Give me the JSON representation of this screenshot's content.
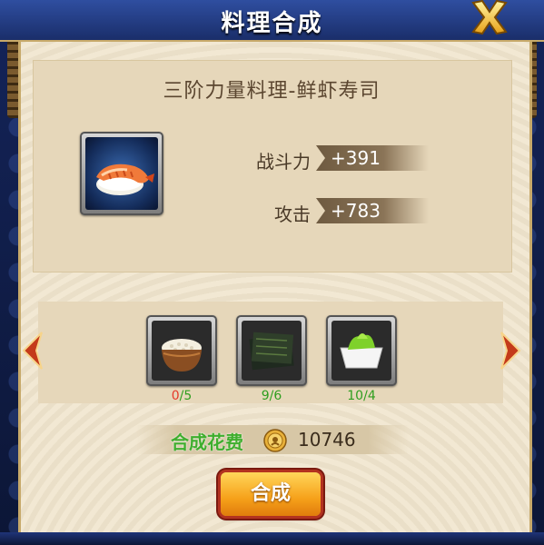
{
  "window": {
    "title": "料理合成"
  },
  "dish": {
    "name": "三阶力量料理-鲜虾寿司",
    "icon": "shrimp-sushi-icon",
    "stats": [
      {
        "label": "战斗力",
        "value": "+391"
      },
      {
        "label": "攻击",
        "value": "+783"
      }
    ]
  },
  "materials": [
    {
      "icon": "rice-bowl-icon",
      "have": "0",
      "need": "5",
      "color": "#e53a2a"
    },
    {
      "icon": "seaweed-icon",
      "have": "9",
      "need": "6",
      "color": "#2f9e1f"
    },
    {
      "icon": "wasabi-icon",
      "have": "10",
      "need": "4",
      "color": "#2f9e1f"
    }
  ],
  "cost": {
    "label": "合成花费",
    "icon": "coin-icon",
    "value": "10746"
  },
  "action": {
    "label": "合成"
  },
  "colors": {
    "accent": "#f6a11a",
    "ok": "#2f9e1f",
    "insufficient": "#e53a2a"
  }
}
